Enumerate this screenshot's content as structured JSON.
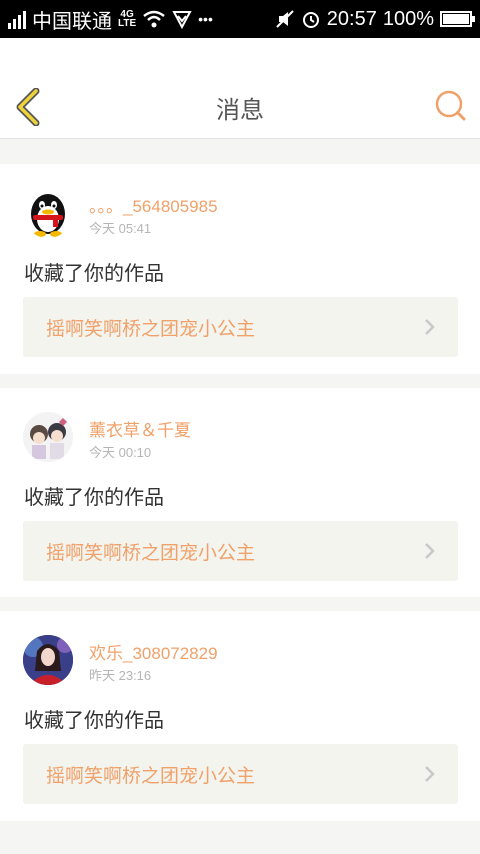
{
  "status_bar": {
    "carrier": "中国联通",
    "network": "4G",
    "network_sub": "LTE",
    "dots": "•••",
    "time": "20:57",
    "battery": "100%"
  },
  "header": {
    "title": "消息",
    "back_icon": "chevron-left-icon",
    "search_icon": "search-icon"
  },
  "colors": {
    "accent": "#f0a16a",
    "back_icon": "#efd33b",
    "page_bg": "#f5f5f3",
    "work_bg": "#f4f4ef"
  },
  "messages": [
    {
      "username": "。。。_564805985",
      "time": "今天 05:41",
      "action": "收藏了你的作品",
      "work_title": "摇啊笑啊桥之团宠小公主",
      "avatar": "qq-penguin-avatar"
    },
    {
      "username": "薰衣草＆千夏",
      "time": "今天 00:10",
      "action": "收藏了你的作品",
      "work_title": "摇啊笑啊桥之团宠小公主",
      "avatar": "anime-avatar"
    },
    {
      "username": "欢乐_308072829",
      "time": "昨天 23:16",
      "action": "收藏了你的作品",
      "work_title": "摇啊笑啊桥之团宠小公主",
      "avatar": "portrait-avatar"
    }
  ]
}
